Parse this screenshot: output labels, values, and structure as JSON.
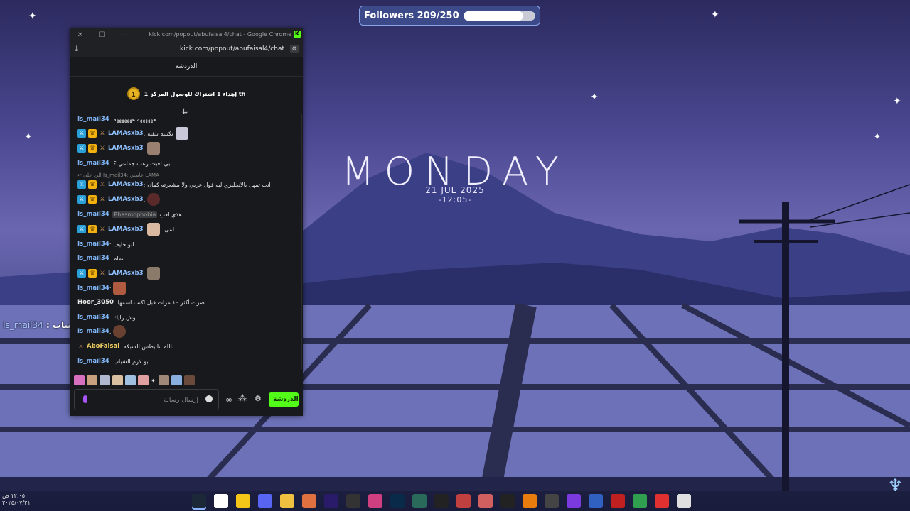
{
  "followers_widget": {
    "label": "Followers 209/250",
    "progress": 0.836
  },
  "wallpaper": {
    "day": "MONDAY",
    "date": "21 JUL 2025",
    "time": "-12:05-"
  },
  "overlay_message": {
    "user": "Is_mail34",
    "separator": " : ",
    "text": "ابو لازم الشباب"
  },
  "browser": {
    "window_title": "kick.com/popout/abufaisal4/chat - Google Chrome",
    "url": "kick.com/popout/abufaisal4/chat",
    "kick_logo": "K"
  },
  "chat": {
    "header": "الدردشة",
    "goal_badge": "1",
    "goal_text": "إهداء 1 اشتراك للوصول المركز 1 th",
    "scroll_icon": "arrow-down-to-line-icon",
    "messages": [
      {
        "user": "Is_mail34",
        "text": "ههههههه هههههههه"
      },
      {
        "user": "LAMAsxb3",
        "text": "تكتبيه تلقيه",
        "badges": true
      },
      {
        "user": "LAMAsxb3",
        "text": "",
        "badges": true
      },
      {
        "user": "Is_mail34",
        "text": "تبي لعبت رعب جماعي ؟"
      },
      {
        "reply": "الرد على Is_mail34: عاطين LAMA"
      },
      {
        "user": "LAMAsxb3",
        "text": "انت تفهل بالانجليزي ليه قول عربي ولا مشعرته كمان",
        "badges": true
      },
      {
        "user": "LAMAsxb3",
        "text": "",
        "badges": true
      },
      {
        "user": "Is_mail34",
        "text": "هذي لعب",
        "chip": "Phasmophobia"
      },
      {
        "user": "LAMAsxb3",
        "text": "لمى",
        "badges": true
      },
      {
        "user": "Is_mail34",
        "text": "ابو خايف"
      },
      {
        "user": "Is_mail34",
        "text": "تمام"
      },
      {
        "user": "LAMAsxb3",
        "text": "",
        "badges": true
      },
      {
        "user": "Is_mail34",
        "text": ""
      },
      {
        "user": "Hoor_3050",
        "text": "صرت أكثر ١٠ مرات قبل اكتب اسمها"
      },
      {
        "user": "Is_mail34",
        "text": "وش رايك"
      },
      {
        "user": "Is_mail34",
        "text": ""
      },
      {
        "user": "AboFaisal",
        "text": "بالله انا بطس الشبكة"
      },
      {
        "user": "Is_mail34",
        "text": "ابو لازم الشباب"
      }
    ],
    "input_placeholder": "إرسال رسالة",
    "send_label": "الدردشة"
  },
  "taskbar": {
    "time": "١٢:٠٥ ص",
    "date": "٢٠٢٥/٠٧/٢١",
    "apps": [
      "Steam",
      "Chrome",
      "Messenger",
      "Discord",
      "File Explorer",
      "Sublime",
      "After Effects",
      "Unity",
      "Browser",
      "Photoshop",
      "Clip Studio",
      "Brush",
      "Game 1",
      "Game 2",
      "IV",
      "Blender",
      "Tool",
      "Premiere",
      "Media",
      "Game 3",
      "Game 4",
      "Voicemod",
      "Store"
    ]
  },
  "colors": {
    "kick_green": "#53fc18",
    "mod_badge": "#2aa0d8",
    "vip_badge": "#f2b10f"
  }
}
